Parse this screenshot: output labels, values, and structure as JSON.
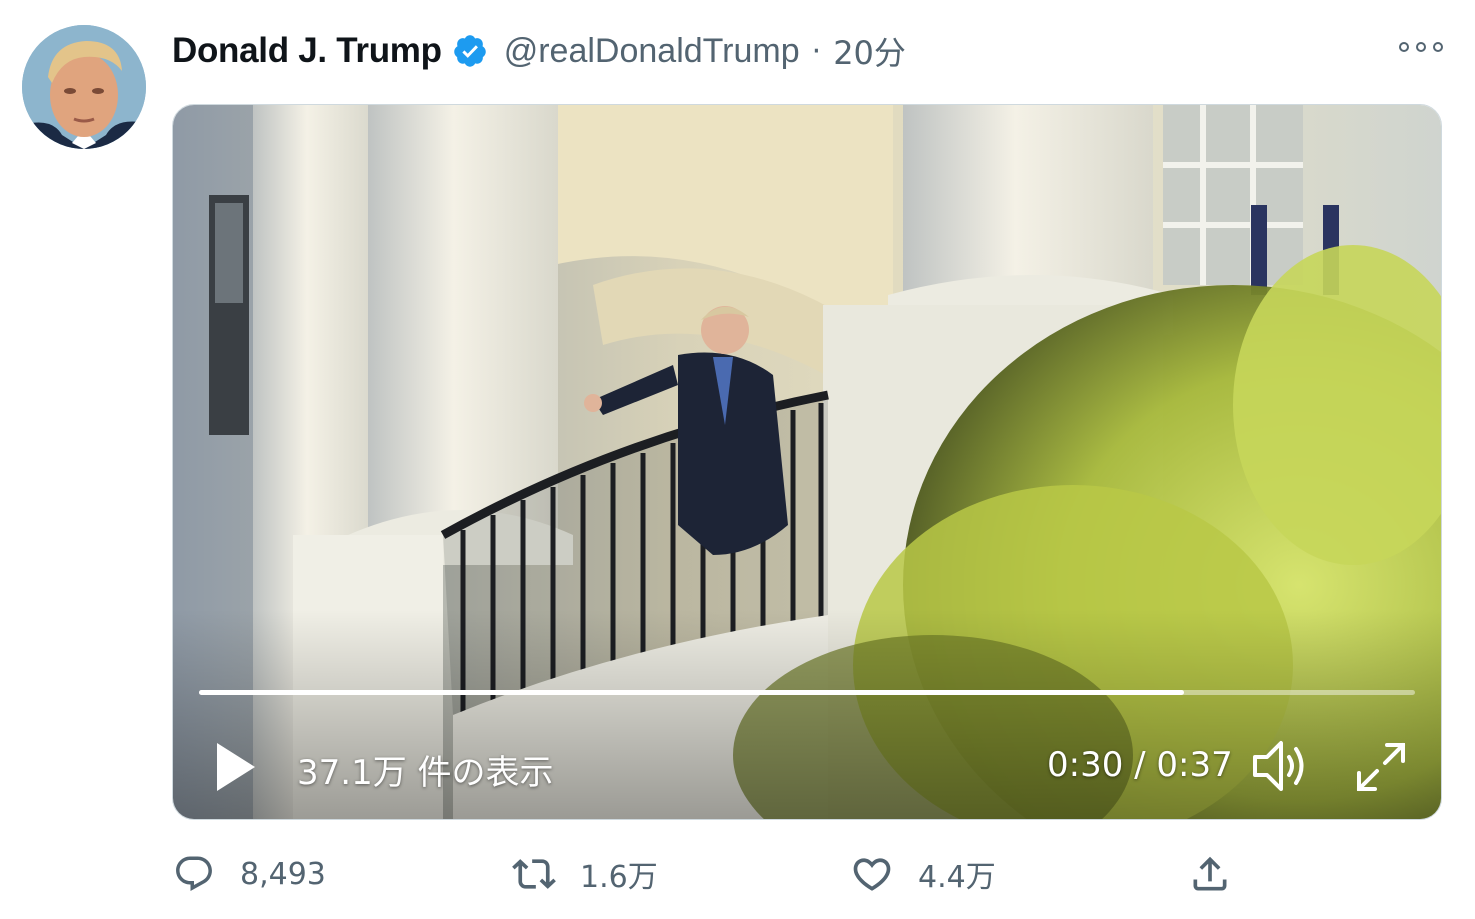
{
  "tweet": {
    "author_name": "Donald J. Trump",
    "handle": "@realDonaldTrump",
    "separator": "·",
    "time": "20分"
  },
  "video": {
    "views": "37.1万 件の表示",
    "duration": "0:30 / 0:37",
    "progress": 0.81
  },
  "actions": {
    "replies": "8,493",
    "retweets": "1.6万",
    "likes": "4.4万"
  },
  "colors": {
    "verified": "#1d9bf0",
    "muted_text": "#536471",
    "primary_text": "#0f1419"
  },
  "icons": [
    "verified-badge-icon",
    "more-icon",
    "play-icon",
    "volume-icon",
    "fullscreen-icon",
    "reply-icon",
    "retweet-icon",
    "like-icon",
    "share-icon"
  ]
}
